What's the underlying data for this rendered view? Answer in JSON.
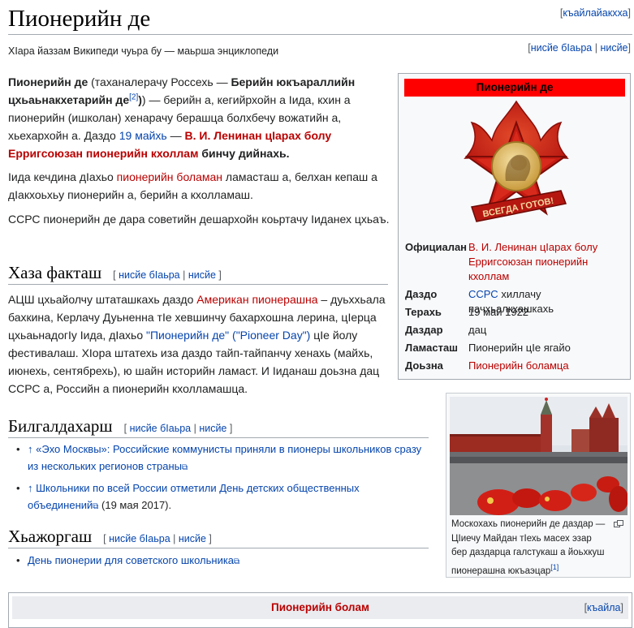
{
  "page": {
    "title": "Пионерийн де",
    "languages_link": "къайлайакхха",
    "tagline": "ХӀара йаззам Википеди чуьра бу — маьрша энциклопеди",
    "top_edit": "нисйе бІаьра",
    "top_edit2": "нисйе"
  },
  "intro": {
    "p1": {
      "t1": "Пионерийн де",
      "t2": " (таханалерачу Россехь — ",
      "t3": "Берийн юкъараллийн цхьаьнакхетарийн де",
      "sup": "[2]",
      "t4": ") — берийн а, кегийрхойн а Іида, кхин а пионерийн (ишколан) хенарачу берашца болхбечу вожатийн а, хьехархойн а. Даздо ",
      "link1": "19 майхь",
      "t5": " — ",
      "link2": "В. И. Ленинан цӀарах болу Ерригсоюзан пионерийн кхоллам",
      "t6": " бинчу дийнахь."
    },
    "p2": {
      "t1": "Іида кечдина дІахьо ",
      "link1": "пионерийн боламан",
      "t2": " ламасташ а, белхан кепаш а дІакхоьхьу пионерийн а, берийн а кхолламаш."
    },
    "p3": "ССРС пионерийн де дара советийн дешархойн коьртачу Іиданех цхьаъ."
  },
  "sections": {
    "facts": {
      "heading": "Хаза факташ",
      "edit1": "нисйе бІаьра",
      "edit2": "нисйе",
      "t1": "АЦШ цхьайолчу штаташкахь даздо ",
      "link1": "Американ пионерашна",
      "t2": " – дуьххьала бахкина, Керлачу Дуьненна тӀе хевшинчу бахархошна лерина, цӀерца цхьаьнадогӀу Іида, дІахьо ",
      "link2": "\"Пионерийн де\" (\"Pioneer Day\")",
      "t3": " цІе йолу фестивалаш. ХӀора штатехь иза даздо тайп-тайпанчу хенахь (майхь, июнехь, сентябрехь), ю шайн историйн ламаст. И Іиданаш доьзна дац ССРС а, Российн а пионерийн кхолламашца."
    },
    "refs": {
      "heading": "Билгалдахарш",
      "edit1": "нисйе бІаьра",
      "edit2": "нисйе",
      "items": [
        {
          "arrow": "↑",
          "text": "«Эхо Москвы»: Российские коммунисты приняли в пионеры школьников сразу из нескольких регионов страны",
          "tail": ""
        },
        {
          "arrow": "↑",
          "text": "Школьники по всей России отметили День детских общественных объединений",
          "tail": " (19 мая 2017)."
        }
      ]
    },
    "links": {
      "heading": "Хьажоргаш",
      "edit1": "нисйе бІаьра",
      "edit2": "нисйе",
      "items": [
        "День пионерии для советского школьника"
      ]
    }
  },
  "infobox": {
    "title": "Пионерийн де",
    "badge_text": "ВСЕГДА ГОТОВ!",
    "rows": [
      {
        "label": "Официалан",
        "value": "В. И. Ленинан цӀарах болу Ерригсоюзан пионерийн кхоллам"
      },
      {
        "label": "Даздо",
        "value_link": "ССРС",
        "value": " хиллачу пачхьалкхашкахь"
      },
      {
        "label": "Терахь",
        "value": "19 май 1922"
      },
      {
        "label": "Даздар",
        "value": "дац"
      },
      {
        "label": "Ламасташ",
        "value": "Пионерийн цӀе ягайо"
      },
      {
        "label": "Доьзна",
        "value": "Пионерийн боламца"
      }
    ]
  },
  "thumb": {
    "caption": "Москохахь пионерийн де даздар — ЦӀиечу Майдан тӀехь масех эзар бер даздарца галстукаш а йоьхкуш пионерашна юкъаэцар",
    "sup": "[1]"
  },
  "navbox": {
    "title": "Пионерийн болам",
    "link": "къайла"
  },
  "colors": {
    "link": "#0645ad",
    "redlink": "#ba0000",
    "infobox_header": "#ff0000",
    "border": "#a2a9b1"
  }
}
